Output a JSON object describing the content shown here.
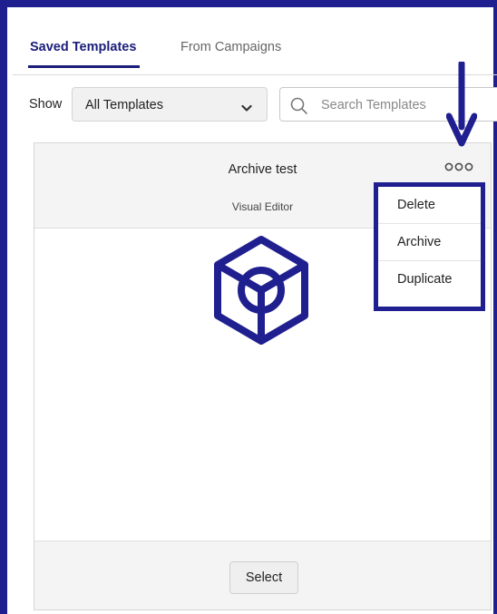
{
  "tabs": [
    {
      "label": "Saved Templates",
      "active": true
    },
    {
      "label": "From Campaigns",
      "active": false
    }
  ],
  "filter": {
    "show_label": "Show",
    "selected": "All Templates",
    "search_placeholder": "Search Templates"
  },
  "card": {
    "title": "Archive test",
    "subtitle": "Visual Editor",
    "select_label": "Select"
  },
  "menu": {
    "items": [
      "Delete",
      "Archive",
      "Duplicate"
    ]
  },
  "colors": {
    "accent": "#1f1f8f",
    "tab_active": "#1b1d7a"
  }
}
